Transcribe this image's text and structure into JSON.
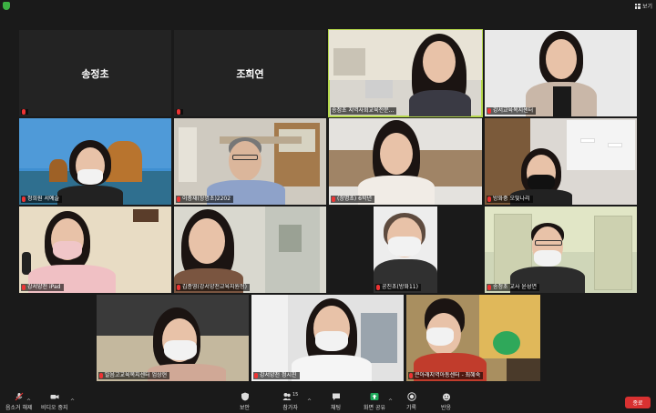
{
  "topbar": {
    "view_label": "보기"
  },
  "tiles": [
    {
      "label": "",
      "name_card": "송정초"
    },
    {
      "label": "",
      "name_card": "조희연"
    },
    {
      "label": "송정초 지역사회교육전문..."
    },
    {
      "label": "강서교육복지센터"
    },
    {
      "label": "정희원 서예슬"
    },
    {
      "label": "이충재(창명초)2202"
    },
    {
      "label": "(창명초) 6학년"
    },
    {
      "label": "방화중 오빛나리"
    },
    {
      "label": "강서양천 iPad"
    },
    {
      "label": "김종영(강서양천교육지원청)"
    },
    {
      "label": "공진초(방화11)"
    },
    {
      "label": "송정초 교사 윤성연"
    },
    {
      "label": "발음고교육복지센터 엄상현"
    },
    {
      "label": "강서양천 정시진"
    },
    {
      "label": "큰아래지역아동센터 - 최혜숙"
    }
  ],
  "toolbar": {
    "unmute": "음소거 해제",
    "video": "비디오 중지",
    "security": "보안",
    "participants": "참가자",
    "participants_count": "15",
    "chat": "채팅",
    "share": "화면 공유",
    "record": "기록",
    "reactions": "반응",
    "end": "종료"
  },
  "colors": {
    "active_speaker": "#b6d94c",
    "end_button": "#d93131",
    "share_green": "#1ea85a"
  }
}
